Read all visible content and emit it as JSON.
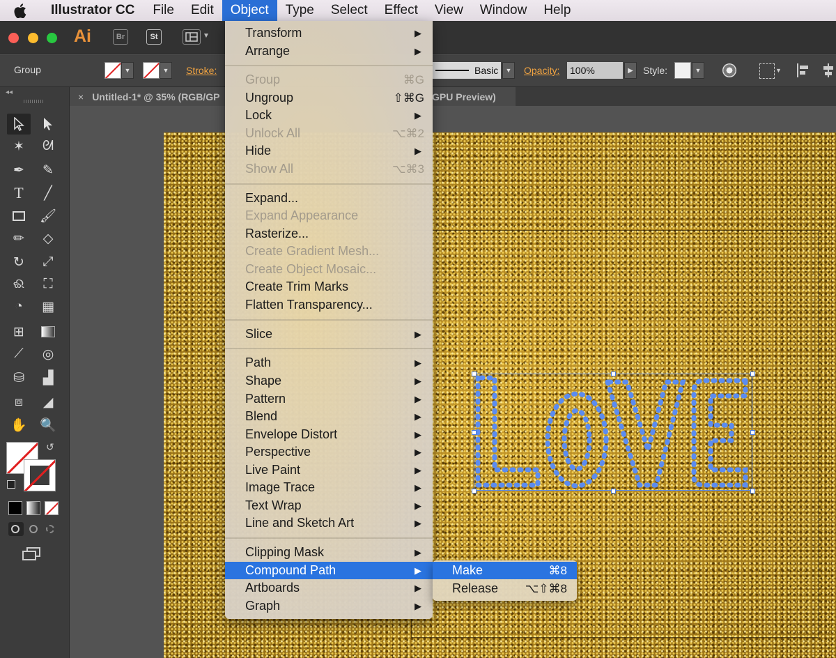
{
  "menubar": {
    "app_name": "Illustrator CC",
    "items": [
      "File",
      "Edit",
      "Object",
      "Type",
      "Select",
      "Effect",
      "View",
      "Window",
      "Help"
    ],
    "active": "Object"
  },
  "app_header": {
    "logo": "Ai",
    "bridge_label": "Br",
    "stock_label": "St"
  },
  "control_bar": {
    "selection_type": "Group",
    "stroke_label": "Stroke:",
    "brush_label": "Basic",
    "opacity_label": "Opacity:",
    "opacity_value": "100%",
    "style_label": "Style:"
  },
  "document_tab": {
    "title": "Untitled-1* @ 35% (RGB/GP",
    "title_suffix": "GPU Preview)",
    "close": "×"
  },
  "object_menu": {
    "items": [
      {
        "label": "Transform",
        "shortcut": "",
        "submenu": true,
        "disabled": false
      },
      {
        "label": "Arrange",
        "shortcut": "",
        "submenu": true,
        "disabled": false
      },
      {
        "label": "Group",
        "shortcut": "⌘G",
        "submenu": false,
        "disabled": true
      },
      {
        "label": "Ungroup",
        "shortcut": "⇧⌘G",
        "submenu": false,
        "disabled": false
      },
      {
        "label": "Lock",
        "shortcut": "",
        "submenu": true,
        "disabled": false
      },
      {
        "label": "Unlock All",
        "shortcut": "⌥⌘2",
        "submenu": false,
        "disabled": true
      },
      {
        "label": "Hide",
        "shortcut": "",
        "submenu": true,
        "disabled": false
      },
      {
        "label": "Show All",
        "shortcut": "⌥⌘3",
        "submenu": false,
        "disabled": true
      },
      {
        "label": "Expand...",
        "shortcut": "",
        "submenu": false,
        "disabled": false
      },
      {
        "label": "Expand Appearance",
        "shortcut": "",
        "submenu": false,
        "disabled": true
      },
      {
        "label": "Rasterize...",
        "shortcut": "",
        "submenu": false,
        "disabled": false
      },
      {
        "label": "Create Gradient Mesh...",
        "shortcut": "",
        "submenu": false,
        "disabled": true
      },
      {
        "label": "Create Object Mosaic...",
        "shortcut": "",
        "submenu": false,
        "disabled": true
      },
      {
        "label": "Create Trim Marks",
        "shortcut": "",
        "submenu": false,
        "disabled": false
      },
      {
        "label": "Flatten Transparency...",
        "shortcut": "",
        "submenu": false,
        "disabled": false
      },
      {
        "label": "Slice",
        "shortcut": "",
        "submenu": true,
        "disabled": false
      },
      {
        "label": "Path",
        "shortcut": "",
        "submenu": true,
        "disabled": false
      },
      {
        "label": "Shape",
        "shortcut": "",
        "submenu": true,
        "disabled": false
      },
      {
        "label": "Pattern",
        "shortcut": "",
        "submenu": true,
        "disabled": false
      },
      {
        "label": "Blend",
        "shortcut": "",
        "submenu": true,
        "disabled": false
      },
      {
        "label": "Envelope Distort",
        "shortcut": "",
        "submenu": true,
        "disabled": false
      },
      {
        "label": "Perspective",
        "shortcut": "",
        "submenu": true,
        "disabled": false
      },
      {
        "label": "Live Paint",
        "shortcut": "",
        "submenu": true,
        "disabled": false
      },
      {
        "label": "Image Trace",
        "shortcut": "",
        "submenu": true,
        "disabled": false
      },
      {
        "label": "Text Wrap",
        "shortcut": "",
        "submenu": true,
        "disabled": false
      },
      {
        "label": "Line and Sketch Art",
        "shortcut": "",
        "submenu": true,
        "disabled": false
      },
      {
        "label": "Clipping Mask",
        "shortcut": "",
        "submenu": true,
        "disabled": false
      },
      {
        "label": "Compound Path",
        "shortcut": "",
        "submenu": true,
        "disabled": false,
        "highlighted": true
      },
      {
        "label": "Artboards",
        "shortcut": "",
        "submenu": true,
        "disabled": false
      },
      {
        "label": "Graph",
        "shortcut": "",
        "submenu": true,
        "disabled": false
      }
    ]
  },
  "compound_path_submenu": {
    "items": [
      {
        "label": "Make",
        "shortcut": "⌘8",
        "highlighted": true
      },
      {
        "label": "Release",
        "shortcut": "⌥⇧⌘8",
        "highlighted": false
      }
    ]
  },
  "icons": {
    "submenu_arrow": "▶",
    "dropdown_arrow": "▼",
    "apple": "apple-icon"
  },
  "colors": {
    "menu_highlight": "#2a74e0",
    "selection_blue": "#5a89e8",
    "app_accent": "#e8913a"
  }
}
